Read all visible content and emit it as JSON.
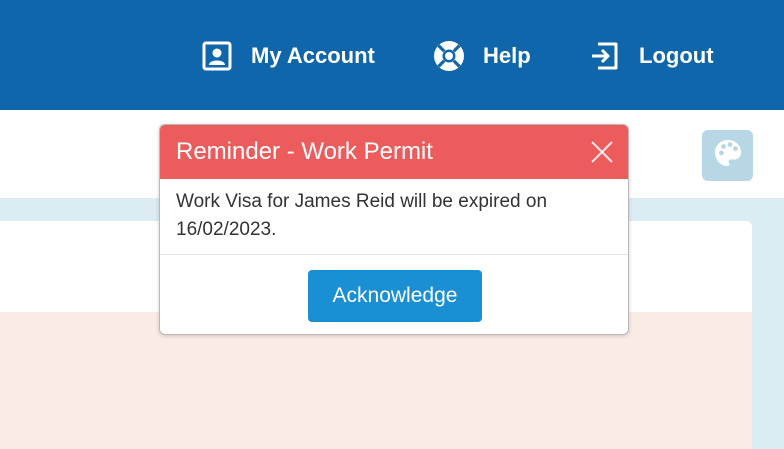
{
  "nav": {
    "my_account_label": "My Account",
    "help_label": "Help",
    "logout_label": "Logout"
  },
  "icons": {
    "account": "user-card-icon",
    "help": "lifebuoy-icon",
    "logout": "sign-out-icon",
    "theme": "palette-icon",
    "close": "close-icon"
  },
  "modal": {
    "title": "Reminder - Work Permit",
    "message": "Work Visa for James Reid will be expired on 16/02/2023.",
    "acknowledge_label": "Acknowledge"
  },
  "colors": {
    "topbar": "#1066ab",
    "modal_header": "#ec5c5c",
    "primary_button": "#1a8fd3",
    "theme_button": "#b8d7e6",
    "content_background": "#dcecf3",
    "card_tint": "#faece5"
  }
}
